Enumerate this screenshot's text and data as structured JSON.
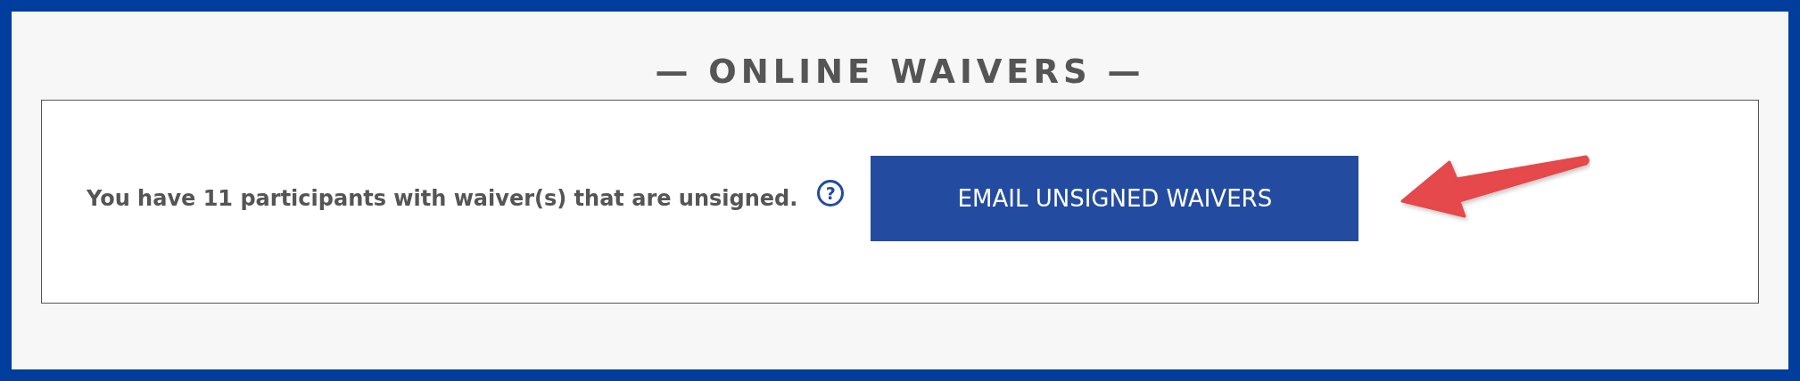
{
  "section": {
    "title": "— ONLINE WAIVERS —"
  },
  "notice": {
    "message": "You have 11 participants with waiver(s) that are unsigned.",
    "help": "?",
    "button": "EMAIL UNSIGNED WAIVERS"
  }
}
